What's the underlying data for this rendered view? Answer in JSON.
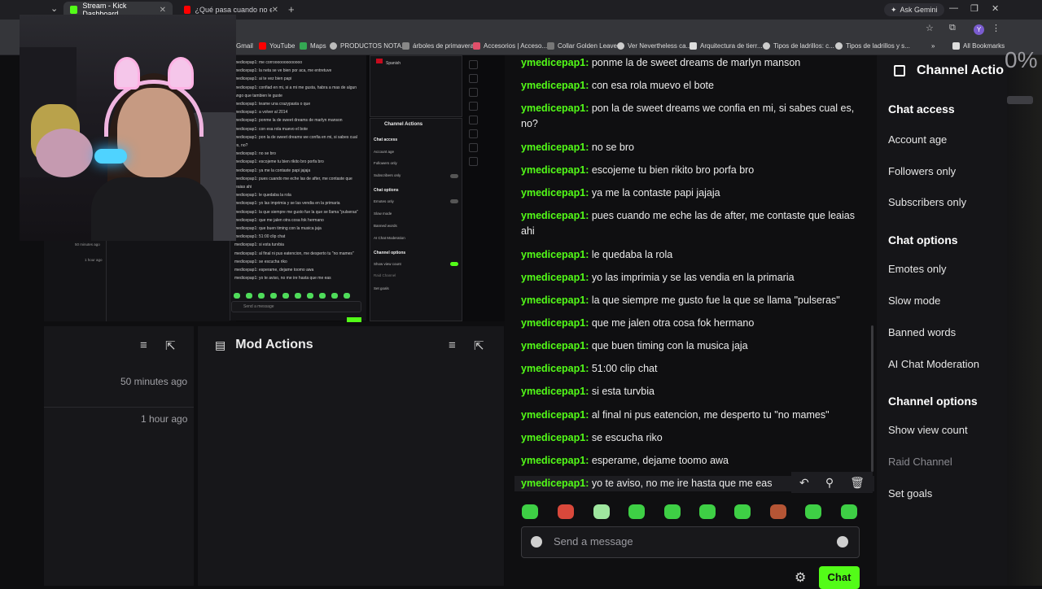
{
  "browser": {
    "tabs": [
      {
        "title": "Stream - Kick Dashboard",
        "active": true,
        "favicon_color": "#53fc18"
      },
      {
        "title": "¿Qué pasa cuando no estamos",
        "active": false,
        "favicon_color": "#ff0000"
      }
    ],
    "ask_label": "Ask Gemini",
    "bookmarks": [
      "Gmail",
      "YouTube",
      "Maps",
      "PRODUCTOS NOTA...",
      "árboles de primavera",
      "Accesorios | Acceso...",
      "Collar Golden Leave...",
      "Ver Nevertheless ca...",
      "Arquitectura de tierr...",
      "Tipos de ladrillos: c...",
      "Tipos de ladrillos y s..."
    ],
    "all_bookmarks": "All Bookmarks",
    "profile_initial": "Y"
  },
  "mini": {
    "lang": "Spanish",
    "chat_lines": [
      "medicepap1: me corrooooooooooooo",
      "medicepap1: la neta se ve bien por aca, me entretuve",
      "medicepap1: ai te vez bien papi",
      "medicepap1: confiad en mi, si a mi me gusta, habra a mas de algun",
      "ango que tambien le guste",
      "medicepap1: teame una crazypasta o que",
      "medicepap1: a volver al 2014",
      "medicepap1: ponme la de sweet dreams de marlyn manson",
      "medicepap1: con esa rola muevo el bote",
      "medicepap1: pon la de sweet dreams we confia en mi, si sabes cual",
      "es, no?",
      "medicepap1: no se bro",
      "medicepap1: escojeme tu bien rikito bro porfa bro",
      "medicepap1: ya me la contaste papi jajaja",
      "medicepap1: pues cuando me eche las de after, me contaste que",
      "leaias ahi",
      "medicepap1: le quedaba la rola",
      "medicepap1: yo las imprimia y se las vendia en la primaria",
      "medicepap1: la que siempre me gusto fue la que se llama \"pulseras\"",
      "medicepap1: que me jalen otra cosa fok hermano",
      "medicepap1: que buen timing con la musica jaja",
      "medicepap1: 51:00 clip chat",
      "medicepap1: si esta turvbia",
      "medicepap1: al final ni pus eatencion, me desperto tu \"no mames\"",
      "medicepap1: se escucha riko",
      "medicepap1: esperame, dejame toomo awa",
      "medicepap1: yo te aviso, no me ire hasta que me eas"
    ],
    "send_placeholder": "Send a message",
    "channel_actions_title": "Channel Actions",
    "chat_access": "Chat access",
    "account_age": "Account age",
    "followers_only": "Followers only",
    "subscribers_only": "Subscribers only",
    "chat_options": "Chat options",
    "emotes_only": "Emotes only",
    "slow_mode": "Slow mode",
    "banned_words": "Banned words",
    "ai_mod": "AI Chat Moderation",
    "channel_options": "Channel options",
    "show_view_count": "Show view count",
    "raid_channel": "Raid Channel",
    "set_goals": "Set goals",
    "off": "Off",
    "time_a": "50 minutes ago",
    "time_b": "1 hour ago"
  },
  "left_panel": {
    "time_1": "50 minutes ago",
    "time_2": "1 hour ago"
  },
  "mod_actions": {
    "title": "Mod Actions"
  },
  "chat": {
    "messages": [
      {
        "user": "ymedicepap1:",
        "text": " ponme la de sweet dreams de marlyn manson"
      },
      {
        "user": "ymedicepap1:",
        "text": " con esa rola muevo el bote"
      },
      {
        "user": "ymedicepap1:",
        "text": " pon la de sweet dreams we confia en mi, si sabes cual es, no?"
      },
      {
        "user": "ymedicepap1:",
        "text": " no se bro"
      },
      {
        "user": "ymedicepap1:",
        "text": " escojeme tu bien rikito bro porfa bro"
      },
      {
        "user": "ymedicepap1:",
        "text": " ya me la contaste papi jajaja"
      },
      {
        "user": "ymedicepap1:",
        "text": " pues cuando me eche las de after, me contaste que leaias ahi"
      },
      {
        "user": "ymedicepap1:",
        "text": " le quedaba la rola"
      },
      {
        "user": "ymedicepap1:",
        "text": " yo las imprimia y se las vendia en la primaria"
      },
      {
        "user": "ymedicepap1:",
        "text": " la que siempre me gusto fue la que se llama \"pulseras\""
      },
      {
        "user": "ymedicepap1:",
        "text": " que me jalen otra cosa fok hermano"
      },
      {
        "user": "ymedicepap1:",
        "text": " que buen timing con la musica jaja"
      },
      {
        "user": "ymedicepap1:",
        "text": " 51:00 clip chat"
      },
      {
        "user": "ymedicepap1:",
        "text": " si esta turvbia"
      },
      {
        "user": "ymedicepap1:",
        "text": " al final ni pus eatencion, me desperto tu \"no mames\""
      },
      {
        "user": "ymedicepap1:",
        "text": " se escucha riko"
      },
      {
        "user": "ymedicepap1:",
        "text": " esperame, dejame toomo awa"
      },
      {
        "user": "ymedicepap1:",
        "text": " yo te aviso, no me ire hasta que me eas"
      }
    ],
    "send_placeholder": "Send a message",
    "chat_button": "Chat",
    "accent": "#53fc18"
  },
  "channel_actions": {
    "title": "Channel Actio",
    "chat_access": "Chat access",
    "account_age": "Account age",
    "followers_only": "Followers only",
    "subscribers_only": "Subscribers only",
    "chat_options": "Chat options",
    "emotes_only": "Emotes only",
    "slow_mode": "Slow mode",
    "banned_words": "Banned words",
    "ai_mod": "AI Chat Moderation",
    "channel_options": "Channel options",
    "show_view_count": "Show view count",
    "raid_channel": "Raid Channel",
    "set_goals": "Set goals"
  },
  "overlay": {
    "percent": "0%"
  }
}
